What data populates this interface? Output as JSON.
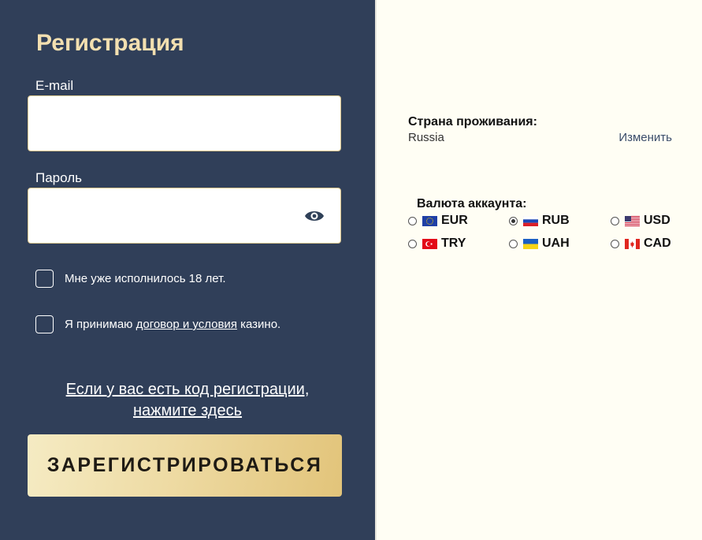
{
  "form": {
    "title": "Регистрация",
    "email_label": "E-mail",
    "email_value": "",
    "password_label": "Пароль",
    "password_value": "",
    "age_check_label": "Мне уже исполнилось 18 лет.",
    "terms_prefix": "Я принимаю ",
    "terms_link": "договор и условия",
    "terms_suffix": " казино.",
    "promo_line1": "Если у вас есть код регистрации,",
    "promo_line2": "нажмите здесь",
    "submit_label": "ЗАРЕГИСТРИРОВАТЬСЯ"
  },
  "country": {
    "label": "Страна проживания:",
    "value": "Russia",
    "change_label": "Изменить"
  },
  "currency": {
    "label": "Валюта аккаунта:",
    "selected": "RUB",
    "options": [
      {
        "code": "EUR",
        "flag": "eu-flag-icon"
      },
      {
        "code": "RUB",
        "flag": "ru-flag-icon"
      },
      {
        "code": "USD",
        "flag": "us-flag-icon"
      },
      {
        "code": "TRY",
        "flag": "tr-flag-icon"
      },
      {
        "code": "UAH",
        "flag": "ua-flag-icon"
      },
      {
        "code": "CAD",
        "flag": "ca-flag-icon"
      }
    ]
  },
  "colors": {
    "panel": "#303f59",
    "accent_gold": "#e2c47a",
    "title_text": "#f2dfb0",
    "background": "#fffef4"
  },
  "icons": {
    "password_toggle": "eye-icon"
  }
}
